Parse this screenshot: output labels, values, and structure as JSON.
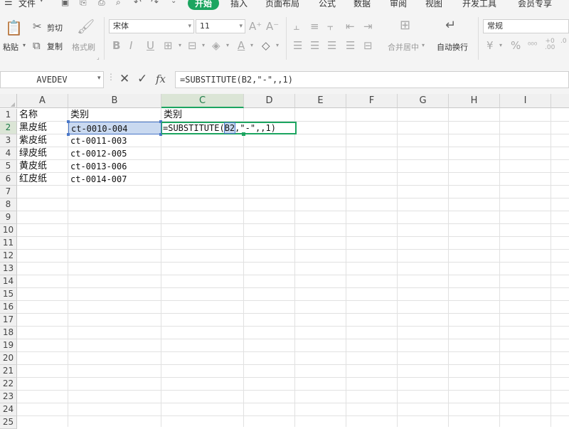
{
  "menu": {
    "file": "文件",
    "tabs": [
      "开始",
      "插入",
      "页面布局",
      "公式",
      "数据",
      "审阅",
      "视图",
      "开发工具",
      "会员专享"
    ]
  },
  "ribbon": {
    "paste": "粘贴",
    "cut": "剪切",
    "copy": "复制",
    "format_painter": "格式刷",
    "font_name": "宋体",
    "font_size": "11",
    "merge_center": "合并居中",
    "wrap_text": "自动换行",
    "number_format": "常规"
  },
  "formula_bar": {
    "name_box": "AVEDEV",
    "fx": "fx",
    "formula": "=SUBSTITUTE(B2,\"-\",,1)"
  },
  "sheet": {
    "columns": [
      "A",
      "B",
      "C",
      "D",
      "E",
      "F",
      "G",
      "H",
      "I"
    ],
    "rows": [
      "1",
      "2",
      "3",
      "4",
      "5",
      "6",
      "7",
      "8",
      "9",
      "10",
      "11",
      "12",
      "13",
      "14",
      "15",
      "16",
      "17",
      "18",
      "19",
      "20",
      "21",
      "22",
      "23",
      "24",
      "25"
    ],
    "cells": {
      "A1": "名称",
      "B1": "类别",
      "C1": "类别",
      "A2": "黑皮纸",
      "B2": "ct-0010-004",
      "C2_prefix": "=SUBSTITUTE(",
      "C2_ref": "B2",
      "C2_suffix": ",\"-\",,1)",
      "A3": "紫皮纸",
      "B3": "ct-0011-003",
      "A4": "绿皮纸",
      "B4": "ct-0012-005",
      "A5": "黄皮纸",
      "B5": "ct-0013-006",
      "A6": "红皮纸",
      "B6": "ct-0014-007"
    }
  },
  "colors": {
    "accent": "#1ca560",
    "ref_highlight": "#c9d9f0",
    "ref_border": "#4a77c8"
  }
}
